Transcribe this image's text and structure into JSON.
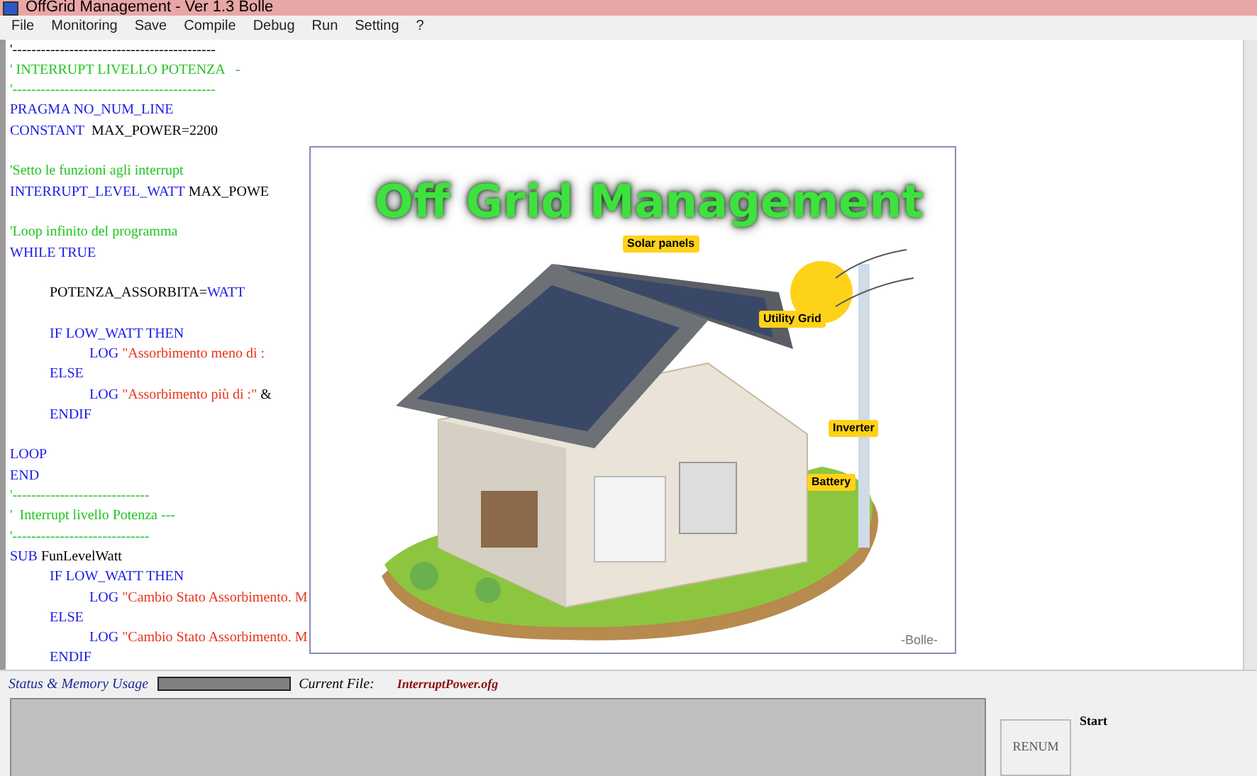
{
  "window": {
    "title": "OffGrid Management - Ver 1.3 Bolle"
  },
  "menu": [
    {
      "label": "File"
    },
    {
      "label": "Monitoring"
    },
    {
      "label": "Save"
    },
    {
      "label": "Compile"
    },
    {
      "label": "Debug"
    },
    {
      "label": "Run"
    },
    {
      "label": "Setting"
    },
    {
      "label": "?"
    }
  ],
  "editor": {
    "lines": [
      {
        "kind": "code",
        "segments": [
          {
            "kind": "plain",
            "text": "'-------------------------------------------"
          }
        ]
      },
      {
        "kind": "code",
        "segments": [
          {
            "kind": "comment",
            "text": "' INTERRUPT LIVELLO POTENZA   -"
          }
        ]
      },
      {
        "kind": "code",
        "segments": [
          {
            "kind": "comment",
            "text": "'-------------------------------------------"
          }
        ]
      },
      {
        "kind": "code",
        "segments": [
          {
            "kind": "keyword",
            "text": "PRAGMA NO_NUM_LINE"
          }
        ]
      },
      {
        "kind": "code",
        "segments": [
          {
            "kind": "keyword",
            "text": "CONSTANT"
          },
          {
            "kind": "plain",
            "text": "  MAX_POWER=2200"
          }
        ]
      },
      {
        "kind": "blank"
      },
      {
        "kind": "code",
        "segments": [
          {
            "kind": "comment",
            "text": "'Setto le funzioni agli interrupt"
          }
        ]
      },
      {
        "kind": "code",
        "segments": [
          {
            "kind": "keyword",
            "text": "INTERRUPT_LEVEL_WATT"
          },
          {
            "kind": "plain",
            "text": " MAX_POWE"
          }
        ]
      },
      {
        "kind": "blank"
      },
      {
        "kind": "code",
        "segments": [
          {
            "kind": "comment",
            "text": "'Loop infinito del programma"
          }
        ]
      },
      {
        "kind": "code",
        "segments": [
          {
            "kind": "keyword",
            "text": "WHILE TRUE"
          }
        ],
        "children": [
          {
            "kind": "blank"
          },
          {
            "kind": "code",
            "segments": [
              {
                "kind": "plain",
                "text": "POTENZA_ASSORBITA="
              },
              {
                "kind": "keyword",
                "text": "WATT"
              }
            ]
          },
          {
            "kind": "blank"
          },
          {
            "kind": "code",
            "segments": [
              {
                "kind": "keyword",
                "text": "IF LOW_WATT THEN"
              }
            ],
            "children": [
              {
                "kind": "code",
                "segments": [
                  {
                    "kind": "keyword",
                    "text": "LOG "
                  },
                  {
                    "kind": "string",
                    "text": "\"Assorbimento meno di :"
                  }
                ]
              }
            ]
          },
          {
            "kind": "code",
            "segments": [
              {
                "kind": "keyword",
                "text": "ELSE"
              }
            ],
            "children": [
              {
                "kind": "code",
                "segments": [
                  {
                    "kind": "keyword",
                    "text": "LOG "
                  },
                  {
                    "kind": "string",
                    "text": "\"Assorbimento più di :\""
                  },
                  {
                    "kind": "plain",
                    "text": " &"
                  }
                ]
              }
            ]
          },
          {
            "kind": "code",
            "segments": [
              {
                "kind": "keyword",
                "text": "ENDIF"
              }
            ]
          },
          {
            "kind": "blank"
          }
        ]
      },
      {
        "kind": "code",
        "segments": [
          {
            "kind": "keyword",
            "text": "LOOP"
          }
        ]
      },
      {
        "kind": "code",
        "segments": [
          {
            "kind": "keyword",
            "text": "END"
          }
        ]
      },
      {
        "kind": "code",
        "segments": [
          {
            "kind": "comment",
            "text": "'-----------------------------"
          }
        ]
      },
      {
        "kind": "code",
        "segments": [
          {
            "kind": "comment",
            "text": "'  Interrupt livello Potenza ---"
          }
        ]
      },
      {
        "kind": "code",
        "segments": [
          {
            "kind": "comment",
            "text": "'-----------------------------"
          }
        ]
      },
      {
        "kind": "code",
        "segments": [
          {
            "kind": "keyword",
            "text": "SUB"
          },
          {
            "kind": "plain",
            "text": " FunLevelWatt"
          }
        ],
        "children": [
          {
            "kind": "code",
            "segments": [
              {
                "kind": "keyword",
                "text": "IF LOW_WATT THEN"
              }
            ],
            "children": [
              {
                "kind": "code",
                "segments": [
                  {
                    "kind": "keyword",
                    "text": "LOG "
                  },
                  {
                    "kind": "string",
                    "text": "\"Cambio Stato Assorbimento. M"
                  }
                ]
              }
            ]
          },
          {
            "kind": "code",
            "segments": [
              {
                "kind": "keyword",
                "text": "ELSE"
              }
            ],
            "children": [
              {
                "kind": "code",
                "segments": [
                  {
                    "kind": "keyword",
                    "text": "LOG "
                  },
                  {
                    "kind": "string",
                    "text": "\"Cambio Stato Assorbimento. M"
                  }
                ]
              }
            ]
          },
          {
            "kind": "code",
            "segments": [
              {
                "kind": "keyword",
                "text": "ENDIF"
              }
            ]
          }
        ]
      }
    ]
  },
  "splash": {
    "title": "Off Grid Management",
    "labels": [
      "Solar panels",
      "Utility Grid",
      "Inverter",
      "Battery"
    ],
    "signature": "-Bolle-"
  },
  "status": {
    "label": "Status & Memory Usage",
    "current_file_label": "Current File:",
    "current_file": "InterruptPower.ofg"
  },
  "side": {
    "button": "RENUM",
    "start_label": "Start"
  }
}
